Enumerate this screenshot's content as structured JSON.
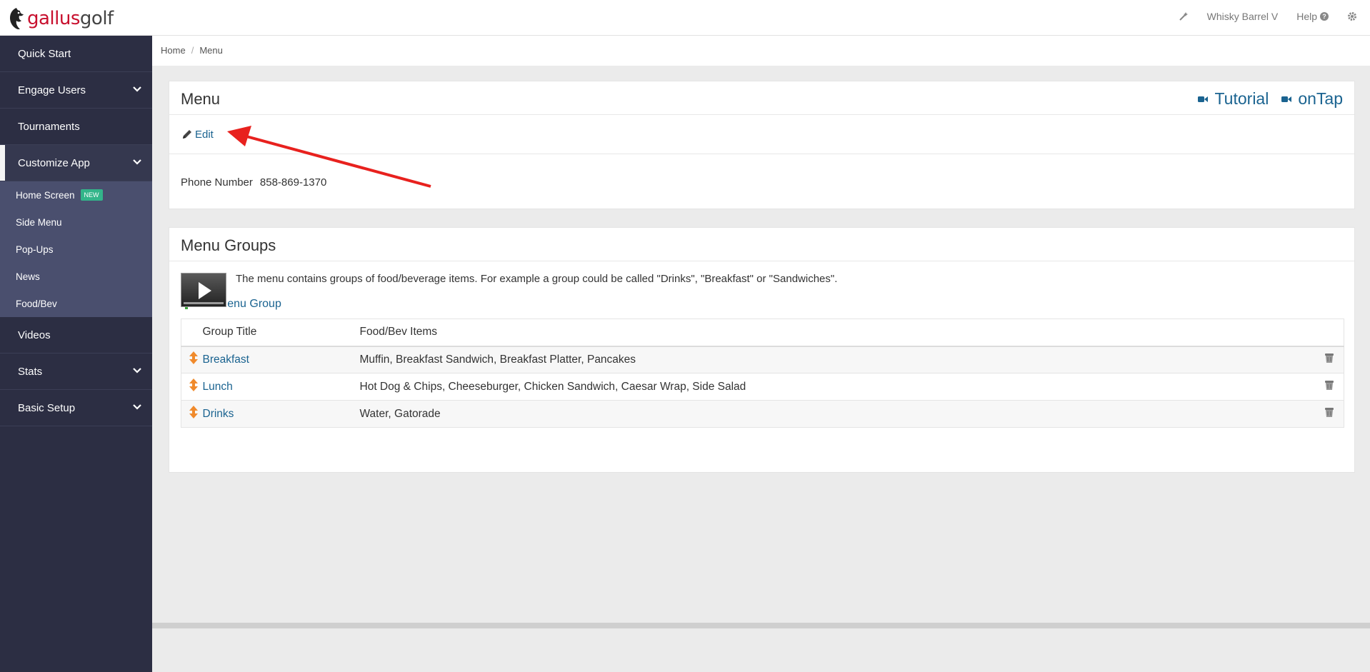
{
  "brand": {
    "part1": "gallus",
    "part2": "golf"
  },
  "topnav": {
    "user": "Whisky Barrel V",
    "help": "Help"
  },
  "sidebar": {
    "items": [
      {
        "label": "Quick Start"
      },
      {
        "label": "Engage Users"
      },
      {
        "label": "Tournaments"
      },
      {
        "label": "Customize App"
      },
      {
        "label": "Videos"
      },
      {
        "label": "Stats"
      },
      {
        "label": "Basic Setup"
      }
    ],
    "subitems": [
      {
        "label": "Home Screen",
        "badge": "NEW"
      },
      {
        "label": "Side Menu"
      },
      {
        "label": "Pop-Ups"
      },
      {
        "label": "News"
      },
      {
        "label": "Food/Bev"
      }
    ]
  },
  "breadcrumb": {
    "home": "Home",
    "separator": "/",
    "current": "Menu"
  },
  "menu_panel": {
    "title": "Menu",
    "tutorial_label": "Tutorial",
    "ontap_label": "onTap",
    "edit_label": "Edit",
    "phone_label": "Phone Number",
    "phone_value": "858-869-1370"
  },
  "groups_panel": {
    "title": "Menu Groups",
    "intro": "The menu contains groups of food/beverage items. For example a group could be called \"Drinks\", \"Breakfast\" or \"Sandwiches\".",
    "add_label": "Add Menu Group",
    "columns": [
      "Group Title",
      "Food/Bev Items"
    ],
    "rows": [
      {
        "title": "Breakfast",
        "items": "Muffin, Breakfast Sandwich, Breakfast Platter, Pancakes"
      },
      {
        "title": "Lunch",
        "items": "Hot Dog & Chips, Cheeseburger, Chicken Sandwich, Caesar Wrap, Side Salad"
      },
      {
        "title": "Drinks",
        "items": "Water, Gatorade"
      }
    ]
  },
  "colors": {
    "sidebar": "#2c2e43",
    "subnav": "#4a4f6e",
    "link": "#1a6390",
    "brand_red": "#c8102e",
    "badge": "#33b58a",
    "annotation_arrow": "#e8211e"
  },
  "icons": {
    "wand": "magic-wand-icon",
    "settings": "gear-icon",
    "edit": "pencil-icon",
    "add": "plus-icon",
    "drag": "sort-arrows-icon",
    "delete": "trash-icon",
    "video": "video-camera-icon"
  }
}
